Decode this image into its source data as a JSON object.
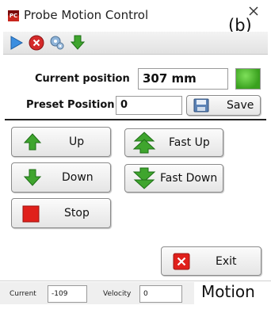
{
  "window": {
    "title": "Probe Motion Control",
    "icon_text": "PC",
    "figure_tag": "(b)"
  },
  "toolbar": {
    "items": [
      {
        "icon": "play-icon"
      },
      {
        "icon": "stop-circle-icon"
      },
      {
        "icon": "settings-icon"
      },
      {
        "icon": "download-arrow-icon"
      }
    ]
  },
  "position": {
    "current_label": "Current position",
    "current_value": "307 mm",
    "indicator_color": "#4cbb2a",
    "preset_label": "Preset Position",
    "preset_value": "0",
    "save_label": "Save"
  },
  "controls": {
    "up_label": "Up",
    "down_label": "Down",
    "stop_label": "Stop",
    "fast_up_label": "Fast Up",
    "fast_down_label": "Fast Down",
    "exit_label": "Exit"
  },
  "status": {
    "current_label": "Current",
    "current_value": "-109",
    "velocity_label": "Velocity",
    "velocity_value": "0"
  },
  "caption": "Motion",
  "colors": {
    "arrow_green": "#3fa52e",
    "stop_red": "#e0201b",
    "toolbar_blue": "#3b8ee0"
  }
}
